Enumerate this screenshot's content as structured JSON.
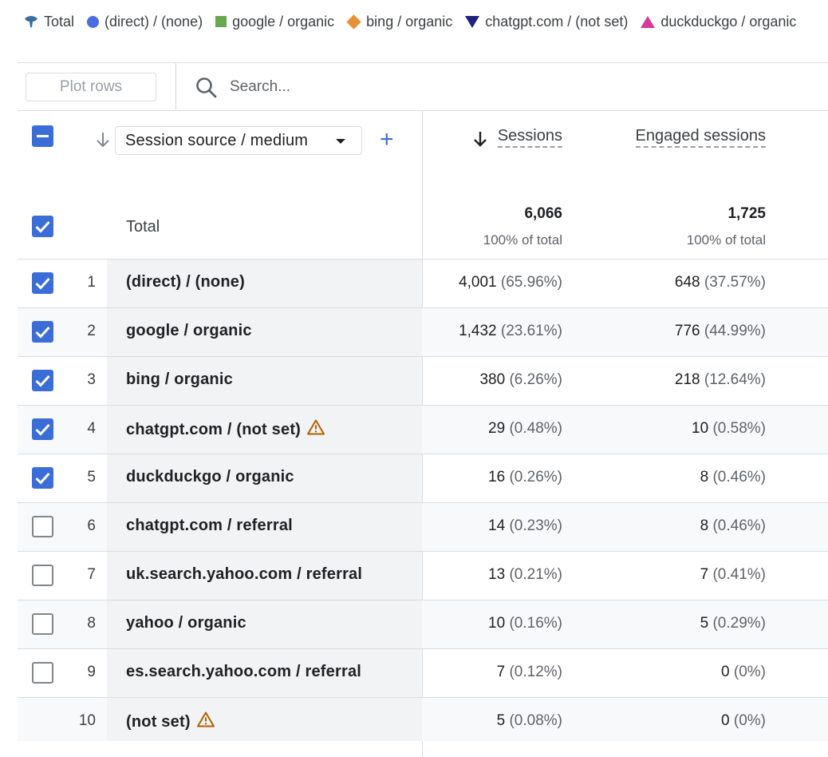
{
  "legend": [
    {
      "label": "Total",
      "symbol": "total",
      "icon": "total-drop-icon"
    },
    {
      "label": "(direct) / (none)",
      "symbol": "circle",
      "color": "#4a6ee0"
    },
    {
      "label": "google / organic",
      "symbol": "square",
      "color": "#6aa84f"
    },
    {
      "label": "bing / organic",
      "symbol": "diamond",
      "color": "#e69138"
    },
    {
      "label": "chatgpt.com / (not set)",
      "symbol": "triangle-down",
      "color": "#1a237e"
    },
    {
      "label": "duckduckgo / organic",
      "symbol": "triangle-up",
      "color": "#d63a9a"
    }
  ],
  "toolbar": {
    "plot_rows_label": "Plot rows",
    "search_placeholder": "Search..."
  },
  "table": {
    "dimension": "Session source / medium",
    "add_dimension": "+",
    "columns": [
      {
        "label": "Sessions",
        "sorted": "descending"
      },
      {
        "label": "Engaged sessions"
      }
    ],
    "total": {
      "label": "Total",
      "sessions": "6,066",
      "sessions_pct": "100% of total",
      "engaged": "1,725",
      "engaged_pct": "100% of total"
    },
    "rows": [
      {
        "index": "1",
        "name": "(direct) / (none)",
        "checked": true,
        "warning": false,
        "sessions": "4,001",
        "sessions_pct": "(65.96%)",
        "engaged": "648",
        "engaged_pct": "(37.57%)"
      },
      {
        "index": "2",
        "name": "google / organic",
        "checked": true,
        "warning": false,
        "sessions": "1,432",
        "sessions_pct": "(23.61%)",
        "engaged": "776",
        "engaged_pct": "(44.99%)"
      },
      {
        "index": "3",
        "name": "bing / organic",
        "checked": true,
        "warning": false,
        "sessions": "380",
        "sessions_pct": "(6.26%)",
        "engaged": "218",
        "engaged_pct": "(12.64%)"
      },
      {
        "index": "4",
        "name": "chatgpt.com / (not set)",
        "checked": true,
        "warning": true,
        "sessions": "29",
        "sessions_pct": "(0.48%)",
        "engaged": "10",
        "engaged_pct": "(0.58%)"
      },
      {
        "index": "5",
        "name": "duckduckgo / organic",
        "checked": true,
        "warning": false,
        "sessions": "16",
        "sessions_pct": "(0.26%)",
        "engaged": "8",
        "engaged_pct": "(0.46%)"
      },
      {
        "index": "6",
        "name": "chatgpt.com / referral",
        "checked": false,
        "warning": false,
        "sessions": "14",
        "sessions_pct": "(0.23%)",
        "engaged": "8",
        "engaged_pct": "(0.46%)"
      },
      {
        "index": "7",
        "name": "uk.search.yahoo.com / referral",
        "checked": false,
        "warning": false,
        "sessions": "13",
        "sessions_pct": "(0.21%)",
        "engaged": "7",
        "engaged_pct": "(0.41%)"
      },
      {
        "index": "8",
        "name": "yahoo / organic",
        "checked": false,
        "warning": false,
        "sessions": "10",
        "sessions_pct": "(0.16%)",
        "engaged": "5",
        "engaged_pct": "(0.29%)"
      },
      {
        "index": "9",
        "name": "es.search.yahoo.com / referral",
        "checked": false,
        "warning": false,
        "sessions": "7",
        "sessions_pct": "(0.12%)",
        "engaged": "0",
        "engaged_pct": "(0%)"
      },
      {
        "index": "10",
        "name": "(not set)",
        "checked": null,
        "warning": true,
        "sessions": "5",
        "sessions_pct": "(0.08%)",
        "engaged": "0",
        "engaged_pct": "(0%)"
      }
    ]
  }
}
